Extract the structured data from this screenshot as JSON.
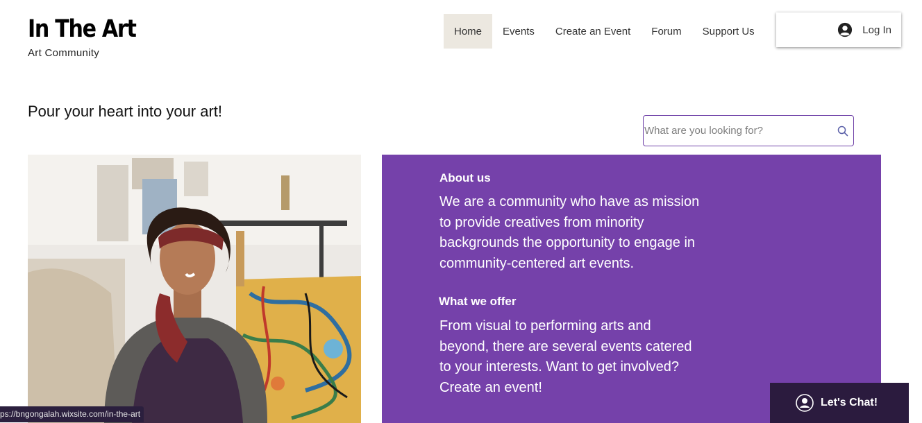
{
  "brand": {
    "title": "In The Art",
    "subtitle": "Art Community"
  },
  "nav": {
    "items": [
      "Home",
      "Events",
      "Create an Event",
      "Forum",
      "Support Us"
    ],
    "active": "Home"
  },
  "login": {
    "label": "Log In",
    "icon": "user-avatar-icon"
  },
  "tagline": "Pour your heart into your art!",
  "search": {
    "placeholder": "What are you looking for?",
    "icon": "search-icon"
  },
  "about": {
    "heading": "About us",
    "text": "We are a community who have as mission to provide creatives from minority backgrounds the opportunity to engage in community-centered art events."
  },
  "offer": {
    "heading": "What we offer",
    "text": "From visual to performing arts and beyond, there are several events catered to your interests. Want to get involved? Create an event!"
  },
  "status_bar": {
    "url": "ps://bngongalah.wixsite.com/in-the-art"
  },
  "chat": {
    "label": "Let's Chat!",
    "icon": "chat-user-icon"
  },
  "colors": {
    "accent_purple": "#7541aa",
    "nav_active_bg": "#ece8e0",
    "chat_bg": "#2b1b3e"
  }
}
